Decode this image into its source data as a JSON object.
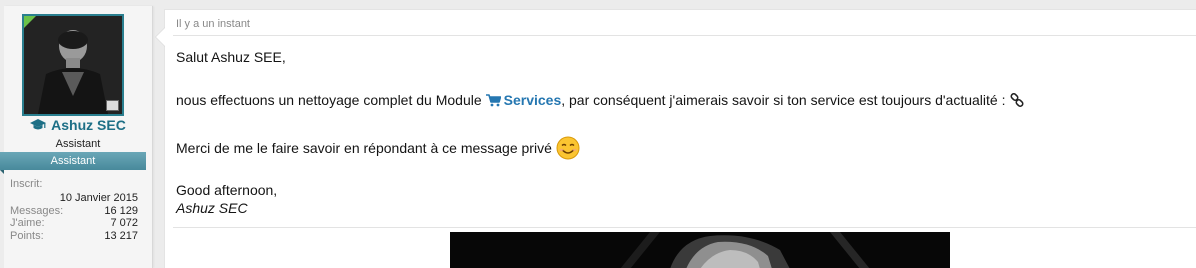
{
  "user": {
    "username": "Ashuz SEC",
    "title": "Assistant",
    "banner": "Assistant",
    "stats": [
      {
        "label": "Inscrit:",
        "value": "10 Janvier 2015"
      },
      {
        "label": "Messages:",
        "value": "16 129"
      },
      {
        "label": "J'aime:",
        "value": "7 072"
      },
      {
        "label": "Points:",
        "value": "13 217"
      }
    ],
    "icons": {
      "username_icon": "graduation-cap-icon"
    },
    "colors": {
      "username": "#1d6f86",
      "banner": "#48899b",
      "avatar_border": "#2a7f8f",
      "online_corner": "#6cc24a"
    }
  },
  "message": {
    "timestamp": "Il y a un instant",
    "greeting": "Salut Ashuz SEE,",
    "main_before": "nous effectuons un nettoyage complet du Module",
    "services_link": "Services",
    "main_after": ", par conséquent j'aimerais savoir si ton service est toujours d'actualité :",
    "thanks": "Merci de me le faire savoir en répondant à ce message privé",
    "sign_off": "Good afternoon,",
    "signature_name": "Ashuz SEC",
    "icons": {
      "services": "cart-icon",
      "link": "chain-link-icon",
      "emoji": "smile-emoji-icon"
    },
    "colors": {
      "link": "#2577b1",
      "timestamp": "#888888"
    }
  }
}
